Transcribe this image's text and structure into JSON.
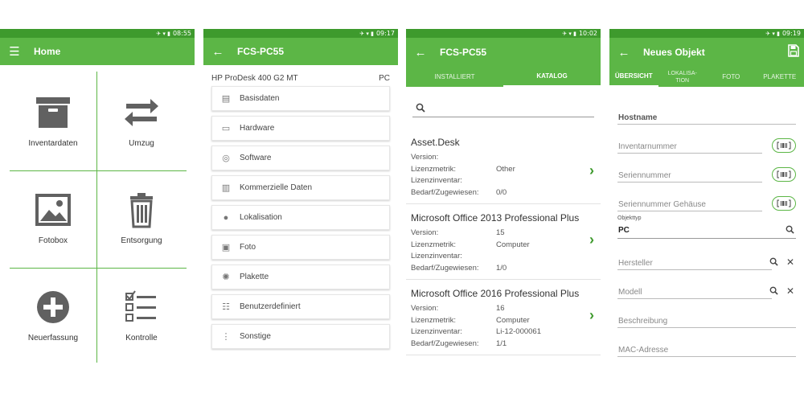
{
  "colors": {
    "primary": "#5cb646",
    "status": "#3e9a2d",
    "chevron": "#3e9a2d"
  },
  "screen1": {
    "time": "08:55",
    "title": "Home",
    "tiles": [
      {
        "label": "Inventardaten",
        "icon": "archive-box-icon"
      },
      {
        "label": "Umzug",
        "icon": "swap-arrows-icon"
      },
      {
        "label": "Fotobox",
        "icon": "image-icon"
      },
      {
        "label": "Entsorgung",
        "icon": "trash-icon"
      },
      {
        "label": "Neuerfassung",
        "icon": "add-circle-icon"
      },
      {
        "label": "Kontrolle",
        "icon": "checklist-icon"
      }
    ]
  },
  "screen2": {
    "time": "09:17",
    "title": "FCS-PC55",
    "device_model": "HP ProDesk 400 G2 MT",
    "device_type": "PC",
    "menu": [
      {
        "label": "Basisdaten",
        "icon": "document-icon"
      },
      {
        "label": "Hardware",
        "icon": "monitor-icon"
      },
      {
        "label": "Software",
        "icon": "disc-icon"
      },
      {
        "label": "Kommerzielle Daten",
        "icon": "bar-chart-icon"
      },
      {
        "label": "Lokalisation",
        "icon": "location-pin-icon"
      },
      {
        "label": "Foto",
        "icon": "photo-icon"
      },
      {
        "label": "Plakette",
        "icon": "badge-icon"
      },
      {
        "label": "Benutzerdefiniert",
        "icon": "list-icon"
      },
      {
        "label": "Sonstige",
        "icon": "more-vertical-icon"
      }
    ]
  },
  "screen3": {
    "time": "10:02",
    "title": "FCS-PC55",
    "tabs": [
      "INSTALLIERT",
      "KATALOG"
    ],
    "active_tab": "KATALOG",
    "labels": {
      "version": "Version:",
      "metric": "Lizenzmetrik:",
      "inventory": "Lizenzinventar:",
      "need": "Bedarf/Zugewiesen:"
    },
    "items": [
      {
        "name": "Asset.Desk",
        "version": "",
        "metric": "Other",
        "inventory": "",
        "need": "0/0"
      },
      {
        "name": "Microsoft Office 2013 Professional Plus",
        "version": "15",
        "metric": "Computer",
        "inventory": "",
        "need": "1/0"
      },
      {
        "name": "Microsoft Office 2016 Professional Plus",
        "version": "16",
        "metric": "Computer",
        "inventory": "Li-12-000061",
        "need": "1/1"
      }
    ]
  },
  "screen4": {
    "time": "09:19",
    "title": "Neues Objekt",
    "tabs": [
      "ÜBERSICHT",
      "LOKALISA-\nTION",
      "FOTO",
      "PLAKETTE"
    ],
    "active_tab": "ÜBERSICHT",
    "hostname": "Hostname",
    "inventory_number": "Inventarnummer",
    "serial_number": "Seriennummer",
    "case_serial": "Seriennummer Gehäuse",
    "object_type_label": "Objekttyp",
    "object_type_value": "PC",
    "manufacturer": "Hersteller",
    "model": "Modell",
    "description": "Beschreibung",
    "mac": "MAC-Adresse"
  }
}
